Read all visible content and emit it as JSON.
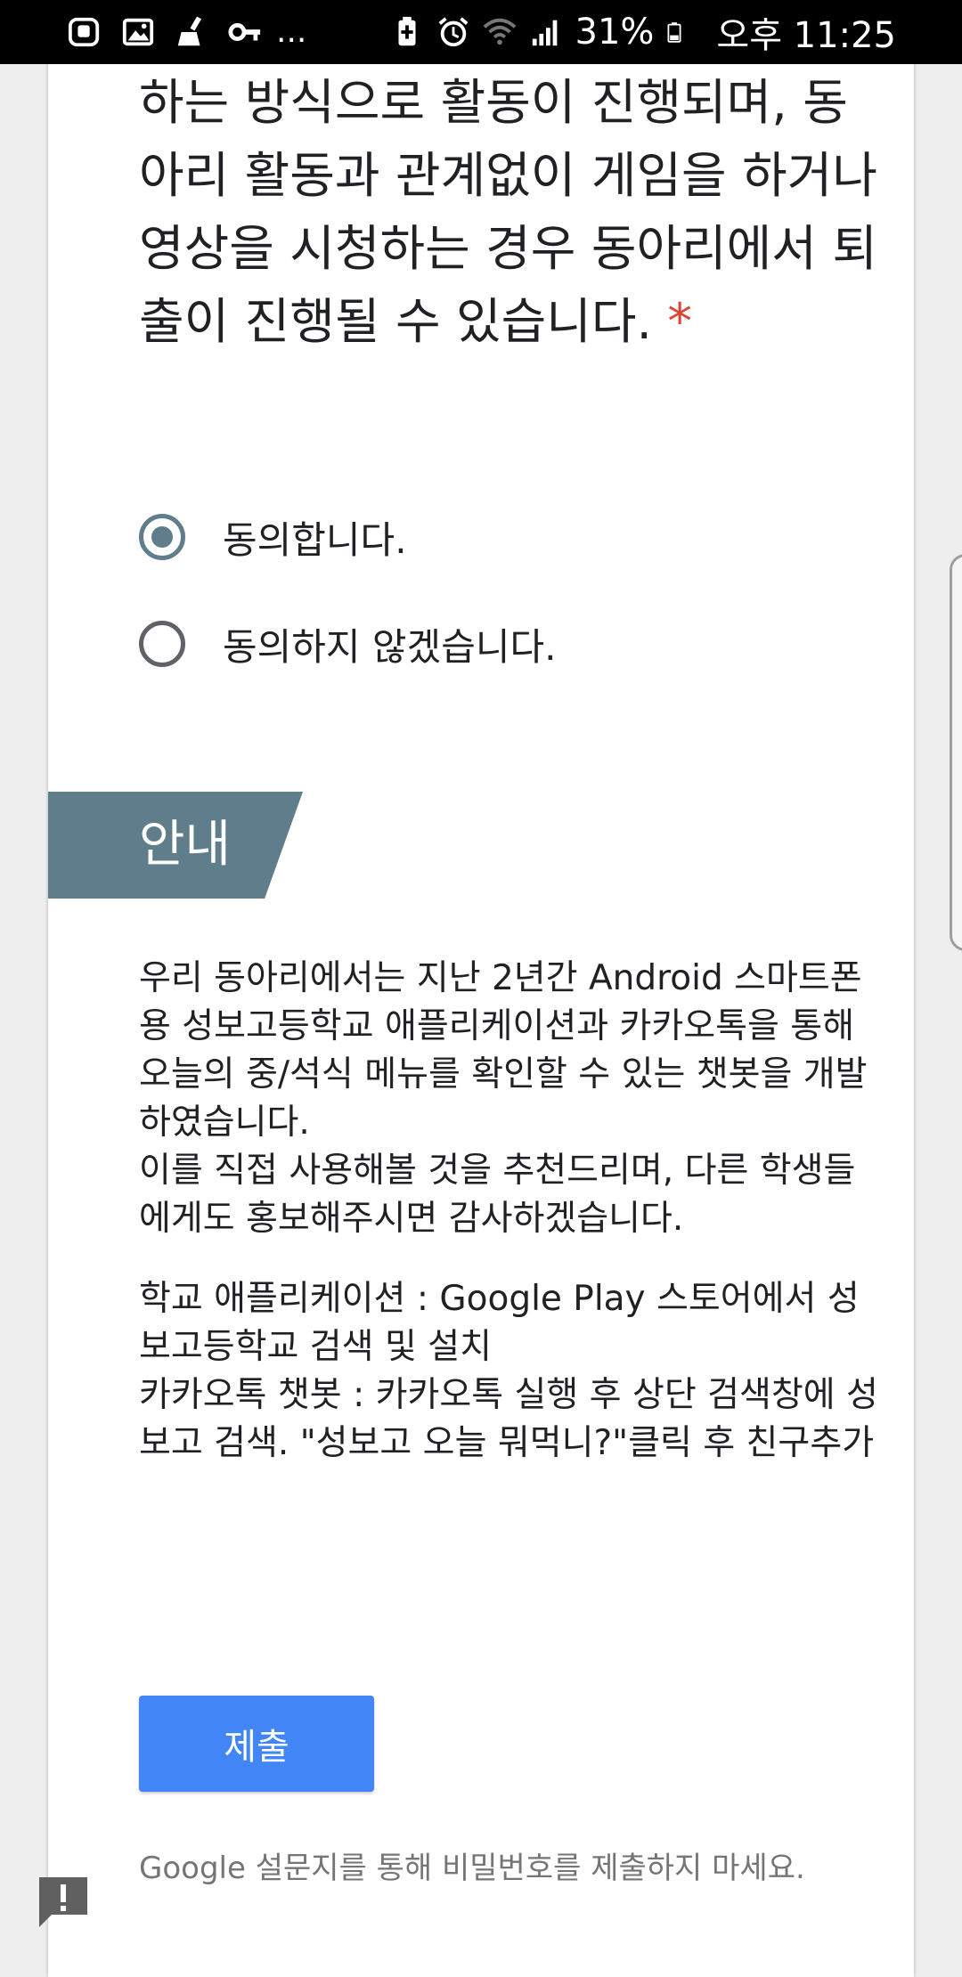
{
  "status_bar": {
    "left_icons": [
      "app-icon",
      "image-icon",
      "broom-icon",
      "key-icon"
    ],
    "more": "...",
    "battery_percent": "31%",
    "time": "오후 11:25"
  },
  "question": {
    "text": "진이 직접 자기주도적으로 개발/학습 하는 방식으로 활동이 진행되며, 동아리 활동과 관계없이 게임을 하거나 영상을 시청하는 경우 동아리에서 퇴출이 진행될 수 있습니다.",
    "required_mark": "*",
    "options": [
      {
        "label": "동의합니다.",
        "selected": true
      },
      {
        "label": "동의하지 않겠습니다.",
        "selected": false
      }
    ]
  },
  "section": {
    "title": "안내",
    "accent_color": "#607d8b",
    "paragraph1_line1": "우리 동아리에서는 지난 2년간 Android 스마트폰용 성보고등학교 애플리케이션과 카카오톡을 통해 오늘의 중/석식 메뉴를 확인할 수 있는 챗봇을 개발하였습니다.",
    "paragraph1_line2": "이를 직접 사용해볼 것을 추천드리며, 다른 학생들에게도 홍보해주시면 감사하겠습니다.",
    "paragraph2_line1": "학교 애플리케이션 : Google Play 스토어에서 성보고등학교 검색 및 설치",
    "paragraph2_line2": "카카오톡 챗봇 : 카카오톡 실행 후 상단 검색창에 성보고 검색. \"성보고 오늘 뭐먹니?\"클릭 후 친구추가"
  },
  "submit_label": "제출",
  "submit_color": "#4285f4",
  "footer_note": "Google 설문지를 통해 비밀번호를 제출하지 마세요.",
  "feedback_icon": "report-icon"
}
